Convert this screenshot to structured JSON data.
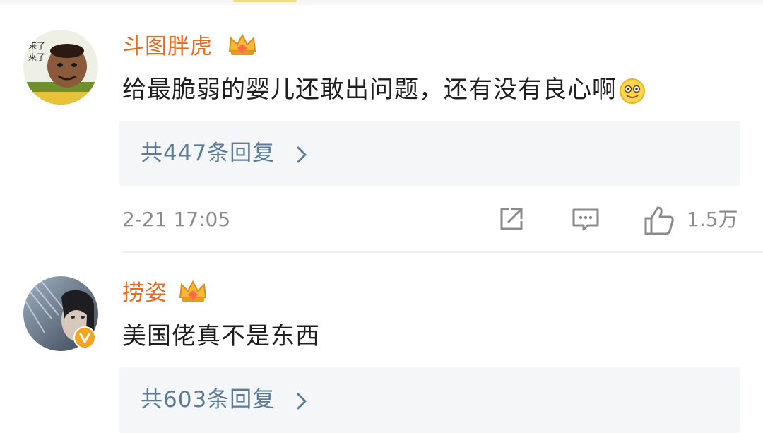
{
  "comments": [
    {
      "username": "斗图胖虎",
      "text": "给最脆弱的婴儿还敢出问题，还有没有良心啊",
      "avatar_text": [
        "来了",
        "来了"
      ],
      "replies_label": "共447条回复",
      "timestamp": "2-21 17:05",
      "like_count": "1.5万"
    },
    {
      "username": "捞姿",
      "text": "美国佬真不是东西",
      "replies_label": "共603条回复"
    }
  ],
  "icons": {
    "crown": "crown-vip-icon",
    "emoji": "grin-emoji-icon",
    "share": "share-icon",
    "comment": "comment-icon",
    "like": "thumbs-up-icon",
    "chevron": "chevron-right-icon",
    "verified": "verified-badge-icon"
  },
  "colors": {
    "username": "#e86b1f",
    "reply_link": "#5b7b99",
    "meta_text": "#8a8a8a",
    "verified_badge": "#f3a521"
  }
}
